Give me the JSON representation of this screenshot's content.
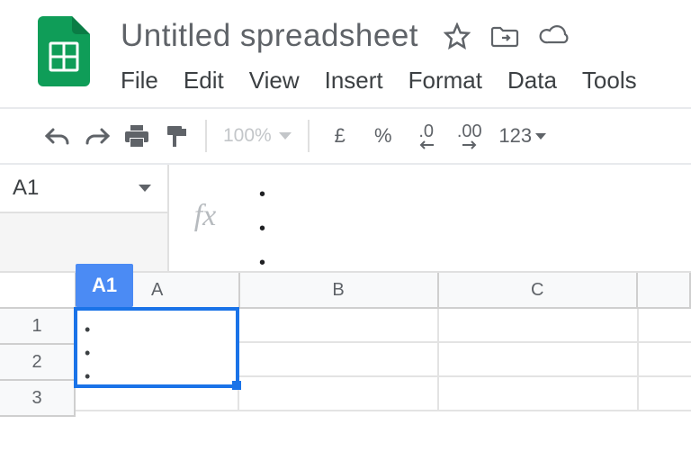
{
  "doc": {
    "title": "Untitled spreadsheet"
  },
  "menu": {
    "items": [
      "File",
      "Edit",
      "View",
      "Insert",
      "Format",
      "Data",
      "Tools"
    ]
  },
  "toolbar": {
    "zoom": "100%",
    "currency": "£",
    "percent": "%",
    "dec_decrease": ".0",
    "dec_increase": ".00",
    "more_formats": "123"
  },
  "namebox": {
    "value": "A1"
  },
  "fx": {
    "symbol": "fx",
    "lines": [
      "•",
      "•",
      "•"
    ]
  },
  "grid": {
    "active_chip": "A1",
    "columns": [
      "A",
      "B",
      "C"
    ],
    "rows": [
      "1",
      "2",
      "3"
    ],
    "cell_A1_lines": [
      "•",
      "•",
      "•"
    ]
  }
}
